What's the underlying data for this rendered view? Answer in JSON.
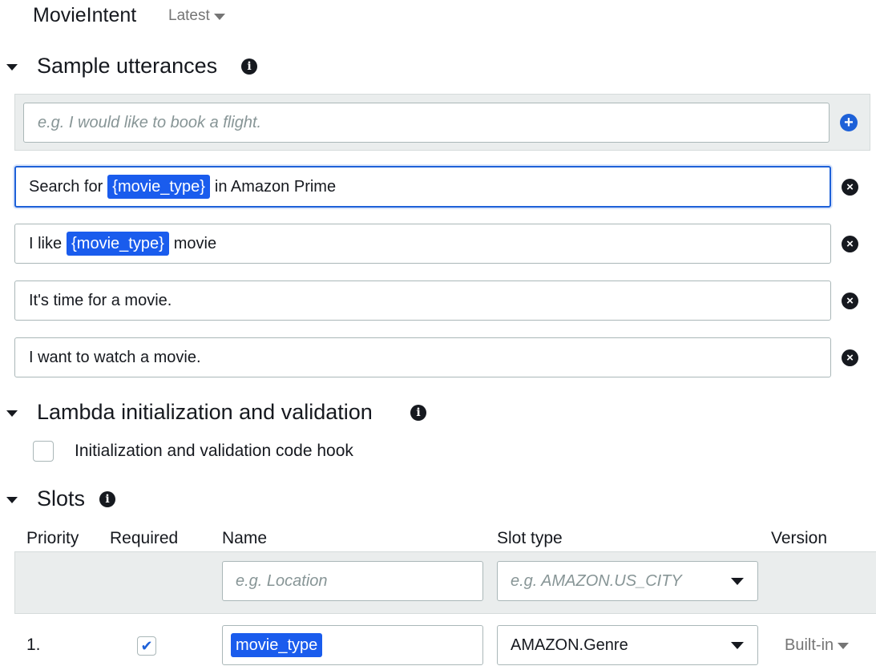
{
  "header": {
    "intent_name": "MovieIntent",
    "version": "Latest"
  },
  "sample_utterances": {
    "title": "Sample utterances",
    "new_placeholder": "e.g. I would like to book a flight.",
    "items": [
      {
        "before": "Search for",
        "slot": "{movie_type}",
        "after": "in Amazon Prime"
      },
      {
        "before": "I like",
        "slot": "{movie_type}",
        "after": "movie"
      },
      {
        "text": "It's time for a movie."
      },
      {
        "text": "I want to watch a movie."
      }
    ]
  },
  "lambda": {
    "title": "Lambda initialization and validation",
    "checkbox_label": "Initialization and validation code hook",
    "checked": false
  },
  "slots": {
    "title": "Slots",
    "columns": {
      "priority": "Priority",
      "required": "Required",
      "name": "Name",
      "slot_type": "Slot type",
      "version": "Version"
    },
    "new_row": {
      "name_placeholder": "e.g. Location",
      "type_placeholder": "e.g. AMAZON.US_CITY"
    },
    "rows": [
      {
        "priority": "1.",
        "required": true,
        "name": "movie_type",
        "slot_type": "AMAZON.Genre",
        "version": "Built-in"
      }
    ]
  },
  "colors": {
    "accent": "#1e61d8",
    "slot_chip": "#1a5ced",
    "panel_bg": "#eaeded",
    "text": "#16191f",
    "muted": "#757575"
  }
}
